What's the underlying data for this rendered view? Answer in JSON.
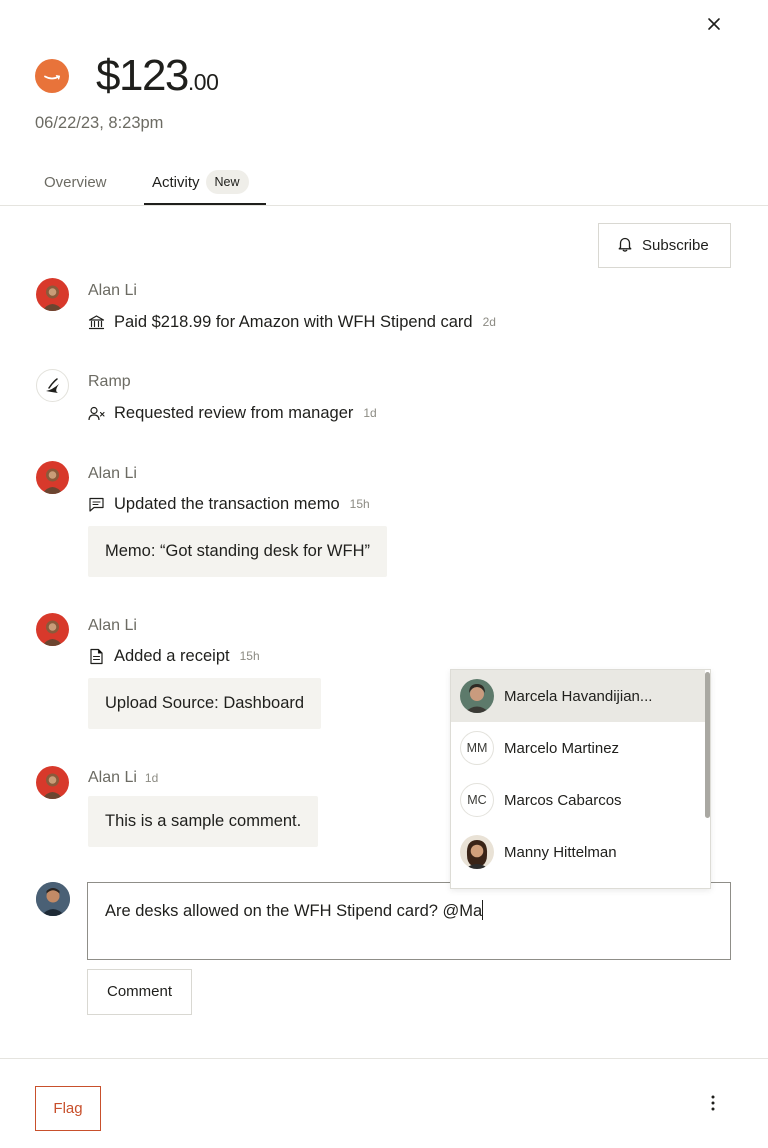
{
  "header": {
    "amount_main": "$123",
    "amount_cents": ".00",
    "date": "06/22/23, 8:23pm",
    "merchant_logo": "amazon-logo-icon"
  },
  "tabs": [
    {
      "label": "Overview",
      "active": false
    },
    {
      "label": "Activity",
      "active": true,
      "badge": "New"
    }
  ],
  "subscribe_label": "Subscribe",
  "activity": [
    {
      "actor": "Alan Li",
      "icon": "bank-icon",
      "text": "Paid $218.99 for Amazon with WFH Stipend card",
      "time": "2d"
    },
    {
      "actor": "Ramp",
      "icon": "user-x-icon",
      "text": "Requested review from manager",
      "time": "1d"
    },
    {
      "actor": "Alan Li",
      "icon": "message-icon",
      "text": "Updated the transaction memo",
      "time": "15h",
      "detail": "Memo: “Got standing desk for WFH”"
    },
    {
      "actor": "Alan Li",
      "icon": "document-icon",
      "text": "Added a receipt",
      "time": "15h",
      "detail": "Upload Source: Dashboard"
    },
    {
      "actor": "Alan Li",
      "time": "1d",
      "detail": "This is a sample comment."
    }
  ],
  "comment": {
    "value": "Are desks allowed on the WFH Stipend card? @Ma",
    "button_label": "Comment"
  },
  "mentions": [
    {
      "name": "Marcela Havandijian...",
      "avatar": "photo",
      "selected": true
    },
    {
      "name": "Marcelo Martinez",
      "initials": "MM"
    },
    {
      "name": "Marcos Cabarcos",
      "initials": "MC"
    },
    {
      "name": "Manny Hittelman",
      "avatar": "photo"
    }
  ],
  "footer": {
    "flag_label": "Flag"
  },
  "colors": {
    "accent_orange": "#c8502c",
    "amazon_orange": "#e8733a",
    "muted_text": "#6c6b63",
    "bubble_bg": "#f4f3ef"
  }
}
